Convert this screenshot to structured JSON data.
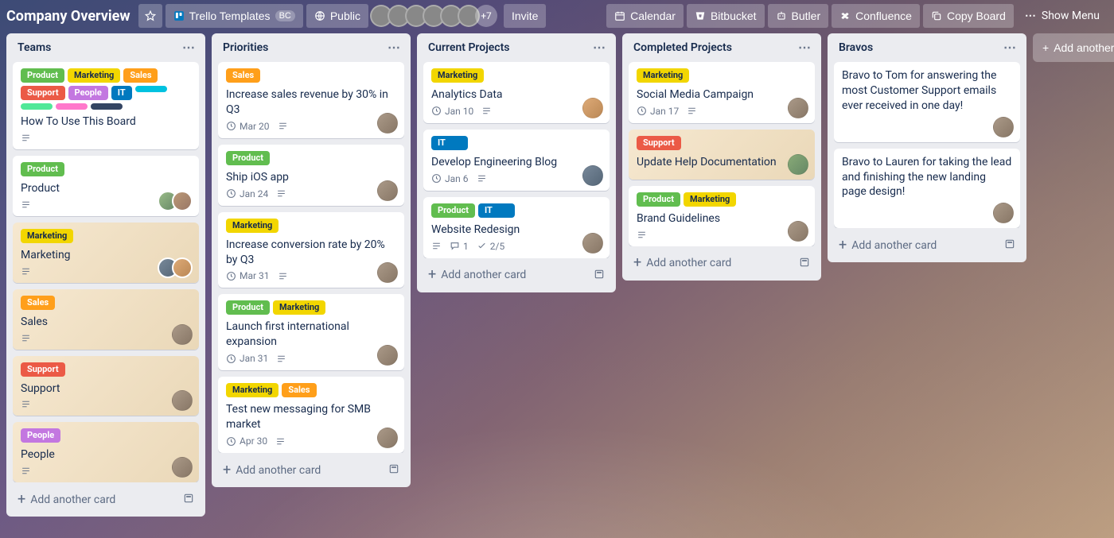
{
  "header": {
    "title": "Company Overview",
    "templates_label": "Trello Templates",
    "templates_badge": "BC",
    "visibility": "Public",
    "avatars_more": "+7",
    "invite": "Invite",
    "buttons": {
      "calendar": "Calendar",
      "bitbucket": "Bitbucket",
      "butler": "Butler",
      "confluence": "Confluence",
      "copy_board": "Copy Board"
    },
    "show_menu": "Show Menu"
  },
  "labels": {
    "product": "Product",
    "marketing": "Marketing",
    "sales": "Sales",
    "support": "Support",
    "people": "People",
    "it": "IT"
  },
  "ui": {
    "add_card": "Add another card",
    "add_list": "Add another list"
  },
  "lists": {
    "teams": {
      "title": "Teams",
      "cards": {
        "howto": "How To Use This Board",
        "product": "Product",
        "marketing": "Marketing",
        "sales": "Sales",
        "support": "Support",
        "people": "People"
      }
    },
    "priorities": {
      "title": "Priorities",
      "cards": {
        "c1": {
          "title": "Increase sales revenue by 30% in Q3",
          "date": "Mar 20"
        },
        "c2": {
          "title": "Ship iOS app",
          "date": "Jan 24"
        },
        "c3": {
          "title": "Increase conversion rate by 20% by Q3",
          "date": "Mar 31"
        },
        "c4": {
          "title": "Launch first international expansion",
          "date": "Jan 31"
        },
        "c5": {
          "title": "Test new messaging for SMB market",
          "date": "Apr 30"
        }
      }
    },
    "current": {
      "title": "Current Projects",
      "cards": {
        "c1": {
          "title": "Analytics Data",
          "date": "Jan 10"
        },
        "c2": {
          "title": "Develop Engineering Blog",
          "date": "Jan 6"
        },
        "c3": {
          "title": "Website Redesign",
          "comments": "1",
          "checklist": "2/5"
        }
      }
    },
    "completed": {
      "title": "Completed Projects",
      "cards": {
        "c1": {
          "title": "Social Media Campaign",
          "date": "Jan 17"
        },
        "c2": {
          "title": "Update Help Documentation"
        },
        "c3": {
          "title": "Brand Guidelines"
        }
      }
    },
    "bravos": {
      "title": "Bravos",
      "cards": {
        "c1": "Bravo to Tom for answering the most Customer Support emails ever received in one day!",
        "c2": "Bravo to Lauren for taking the lead and finishing the new landing page design!"
      }
    }
  }
}
